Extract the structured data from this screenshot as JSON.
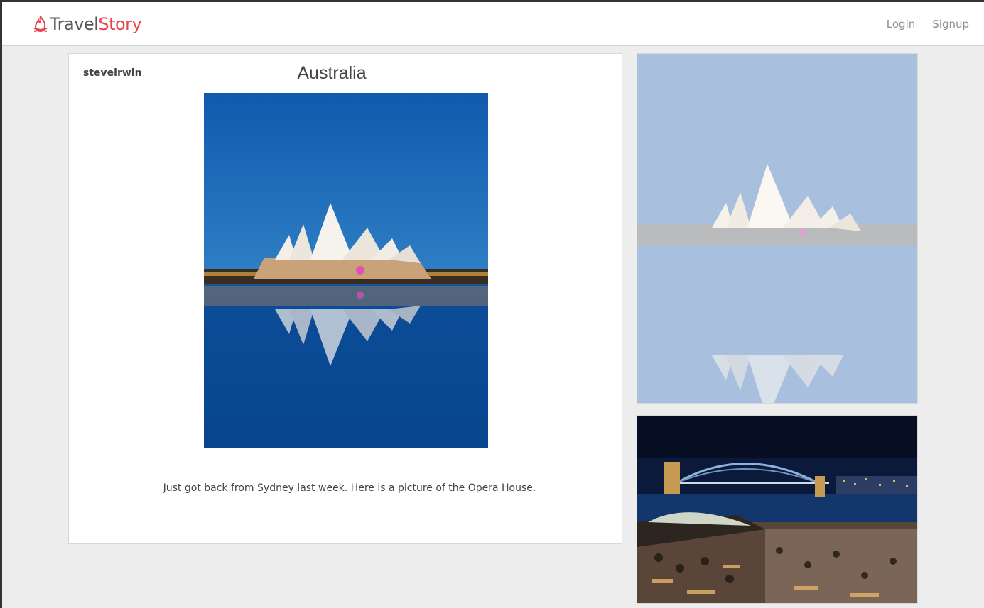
{
  "navbar": {
    "brand_part1": "Travel",
    "brand_part2": "Story",
    "brand_color": "#e5454c",
    "links": [
      {
        "label": "Login"
      },
      {
        "label": "Signup"
      }
    ]
  },
  "post": {
    "username": "steveirwin",
    "title": "Australia",
    "caption": "Just got back from Sydney last week. Here is a picture of the Opera House.",
    "image_icon": "opera-house-photo"
  },
  "sidebar": {
    "photos": [
      {
        "icon": "opera-house-faded-photo"
      },
      {
        "icon": "harbour-bridge-night-photo"
      }
    ]
  }
}
